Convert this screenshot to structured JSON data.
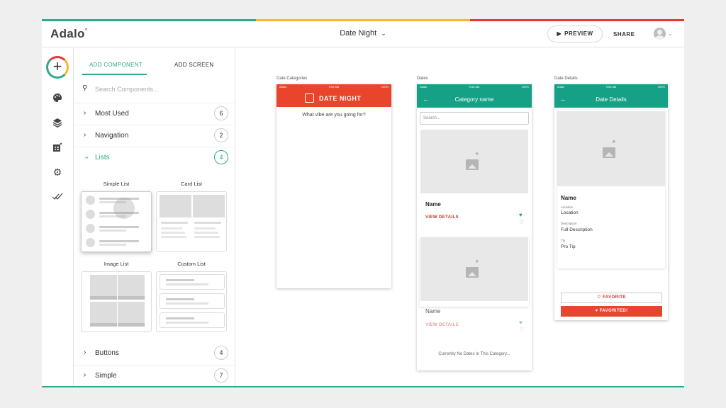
{
  "topbar": {
    "logo": "Adalo",
    "app_name": "Date Night",
    "preview_label": "PREVIEW",
    "share_label": "SHARE"
  },
  "colors": {
    "accent_green": "#2eaa8f",
    "accent_red": "#e53935",
    "accent_yellow": "#f7b731",
    "header_teal": "#16a085"
  },
  "iconbar": {
    "icons": [
      "plus-icon",
      "palette-icon",
      "layers-icon",
      "database-icon",
      "gear-icon",
      "double-check-icon"
    ]
  },
  "panel": {
    "tab_add_component": "ADD COMPONENT",
    "tab_add_screen": "ADD SCREEN",
    "search_placeholder": "Search Components...",
    "categories": [
      {
        "label": "Most Used",
        "count": "6"
      },
      {
        "label": "Navigation",
        "count": "2"
      },
      {
        "label": "Lists",
        "count": "4"
      },
      {
        "label": "Buttons",
        "count": "4"
      },
      {
        "label": "Simple",
        "count": "7"
      }
    ],
    "list_components": [
      "Simple List",
      "Card List",
      "Image List",
      "Custom List"
    ]
  },
  "canvas": {
    "status": {
      "carrier": "Adalo",
      "time": "9:55 AM",
      "battery": "100%"
    },
    "screen1": {
      "label": "Date Categories",
      "header_title": "DATE NIGHT",
      "prompt": "What vibe are you going for?"
    },
    "screen2": {
      "label": "Dates",
      "header_title": "Category name",
      "search_placeholder": "Search...",
      "item1_name": "Name",
      "item1_link": "VIEW DETAILS",
      "item2_name": "Name",
      "item2_link": "VIEW DETAILS",
      "empty_text": "Currently No Dates In This Category..."
    },
    "screen3": {
      "label": "Date Details",
      "header_title": "Date Details",
      "name": "Name",
      "location_label": "Location",
      "location_value": "Location",
      "description_label": "Description",
      "description_value": "Full Description",
      "tip_label": "Tip",
      "tip_value": "Pro Tip",
      "favorite_label": "FAVORITE",
      "favorited_label": "FAVORITED!"
    }
  }
}
